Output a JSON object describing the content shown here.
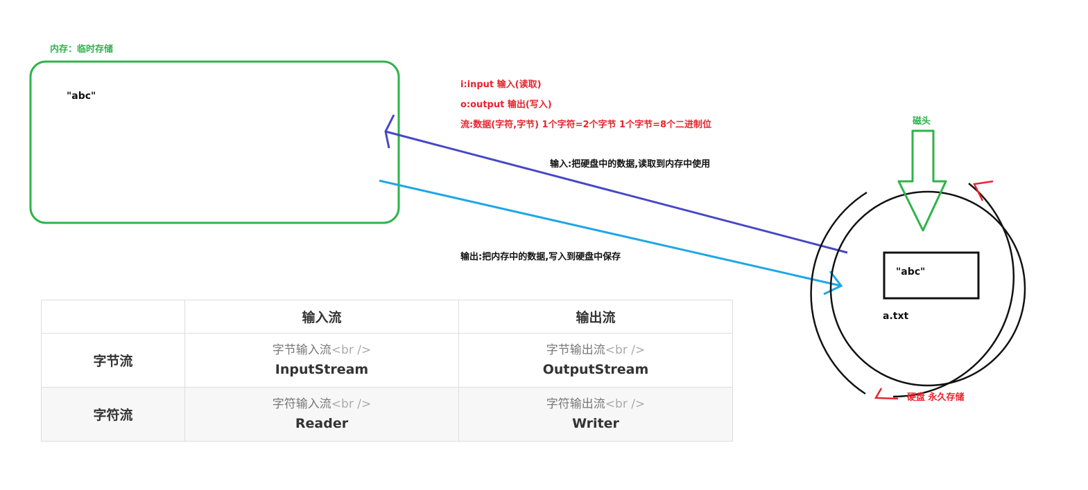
{
  "memory": {
    "label": "内存：临时存储",
    "value": "\"abc\""
  },
  "notes": {
    "input": "i:input 输入(读取)",
    "output": "o:output 输出(写入)",
    "stream": "流:数据(字符,字节) 1个字符=2个字节 1个字节=8个二进制位"
  },
  "arrows": {
    "read_label": "输入:把硬盘中的数据,读取到内存中使用",
    "write_label": "输出:把内存中的数据,写入到硬盘中保存"
  },
  "disk": {
    "head_label": "磁头",
    "value": "\"abc\"",
    "file_name": "a.txt",
    "label": "硬盘 永久存储"
  },
  "colors": {
    "memory_box": "#2db34a",
    "read_arrow": "#4646c8",
    "write_arrow": "#1ea6e6",
    "note_red": "#e8232d",
    "head_arrow": "#2db34a"
  },
  "table": {
    "headers": [
      "",
      "输入流",
      "输出流"
    ],
    "rows": [
      {
        "label": "字节流",
        "cells": [
          {
            "top": "字节输入流",
            "tag": "<br />",
            "bottom": "InputStream"
          },
          {
            "top": "字节输出流",
            "tag": "<br />",
            "bottom": "OutputStream"
          }
        ]
      },
      {
        "label": "字符流",
        "cells": [
          {
            "top": "字符输入流",
            "tag": "<br />",
            "bottom": "Reader"
          },
          {
            "top": "字符输出流",
            "tag": "<br />",
            "bottom": "Writer"
          }
        ]
      }
    ]
  }
}
